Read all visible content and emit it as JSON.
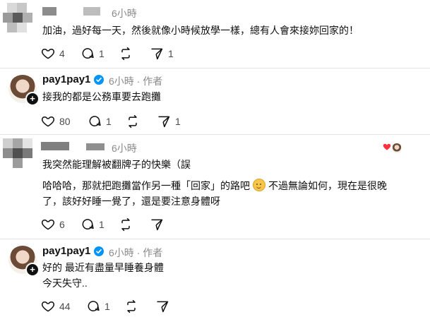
{
  "comments": [
    {
      "time": "6小時",
      "text_lines": [
        "加油，過好每一天，然後就像小時候放學一樣，總有人會來接妳回家的！"
      ],
      "likes": "4",
      "replies": "1",
      "shares": "1"
    },
    {
      "username": "pay1pay1",
      "time": "6小時",
      "author_tag": "作者",
      "text_lines": [
        "接我的都是公務車要去跑攤"
      ],
      "likes": "80",
      "replies": "1",
      "shares": "1"
    },
    {
      "time": "6小時",
      "text_lines": [
        "我突然能理解被翻牌子的快樂（誤"
      ],
      "text_lines_2": [
        "哈哈哈，那就把跑攤當作另一種「回家」的路吧",
        "不過無論如何，現在是很晚",
        "了，該好好睡一覺了，還是要注意身體呀"
      ],
      "likes": "6",
      "replies": "1"
    },
    {
      "username": "pay1pay1",
      "time": "6小時",
      "author_tag": "作者",
      "text_lines": [
        "好的 最近有盡量早睡養身體",
        "今天失守.."
      ],
      "likes": "44",
      "replies": "1"
    }
  ],
  "separator": "·",
  "colors": {
    "verified": "#0095f6",
    "liked_heart": "#ff3040",
    "muted": "#8a8a8a"
  },
  "icons": [
    "heart-icon",
    "reply-icon",
    "repost-icon",
    "share-icon",
    "verified-icon",
    "plus-icon",
    "emoji-icon",
    "menu-dots-icon"
  ]
}
